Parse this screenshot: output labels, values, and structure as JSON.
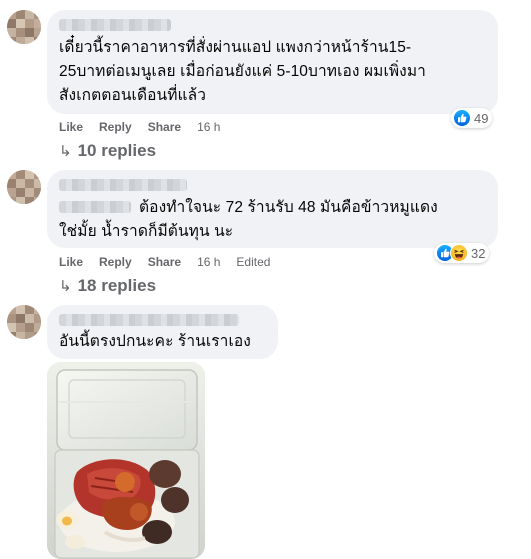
{
  "comments": [
    {
      "text": "เดี๋ยวนี้ราคาอาหารที่สั่งผ่านแอป แพงกว่าหน้าร้าน15-\n25บาทต่อเมนูเลย เมื่อก่อนยังแค่ 5-10บาทเอง ผมเพิ่งมา\nสังเกตตอนเดือนที่แล้ว",
      "actions": {
        "like": "Like",
        "reply": "Reply",
        "share": "Share",
        "time": "16 h"
      },
      "reactions": {
        "icons": [
          "like-icon"
        ],
        "count": "49"
      },
      "replies": "10 replies"
    },
    {
      "text": "ต้องทำใจนะ 72 ร้านรับ 48 มันคือข้าวหมูแดง\nใช่มั้ย น้ำราดก็มีต้นทุน นะ",
      "actions": {
        "like": "Like",
        "reply": "Reply",
        "share": "Share",
        "time": "16 h",
        "edited": "Edited"
      },
      "reactions": {
        "icons": [
          "like-icon",
          "haha-icon"
        ],
        "count": "32"
      },
      "replies": "18 replies"
    },
    {
      "text": "อันนี้ตรงปกนะคะ ร้านเราเอง",
      "photo": "red-pork-rice-box-photo"
    }
  ],
  "colors": {
    "bubble": "#f0f2f5",
    "meta_text": "#65676b",
    "like_blue": "#1877f2",
    "haha_yellow": "#f7b125"
  }
}
